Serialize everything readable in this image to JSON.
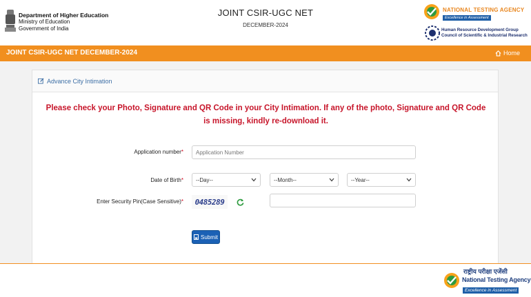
{
  "header": {
    "dept_line1": "Department of Higher Education",
    "dept_line2": "Ministry of Education",
    "dept_line3": "Government of India",
    "title": "JOINT CSIR-UGC NET",
    "subtitle": "DECEMBER-2024",
    "nta_name": "NATIONAL TESTING AGENCY",
    "nta_tagline": "Excellence in Assessment",
    "csir_line1": "Human Resource Development Group",
    "csir_line2": "Council of Scientific & Industrial Research"
  },
  "navbar": {
    "title": "JOINT CSIR-UGC NET DECEMBER-2024",
    "home_label": "Home"
  },
  "card": {
    "heading": "Advance City Intimation",
    "notice": "Please check your Photo, Signature and QR Code in your City Intimation. If any of the photo, Signature and QR Code is missing, kindly re-download it."
  },
  "form": {
    "app_label": "Application number",
    "app_placeholder": "Application Number",
    "dob_label": "Date of Birth",
    "day_value": "--Day--",
    "month_value": "--Month--",
    "year_value": "--Year--",
    "pin_label": "Enter Security Pin(Case Sensitive)",
    "captcha_text": "0485289",
    "required_mark": "*",
    "submit_label": "Submit"
  },
  "footer": {
    "hindi_name": "राष्ट्रीय परीक्षा एजेंसी",
    "name": "National Testing Agency",
    "tagline": "Excellence in Assessment"
  },
  "colors": {
    "accent": "#f18f1f",
    "notice": "#c7152a",
    "button": "#1b61b5",
    "link": "#3c6ea5"
  }
}
